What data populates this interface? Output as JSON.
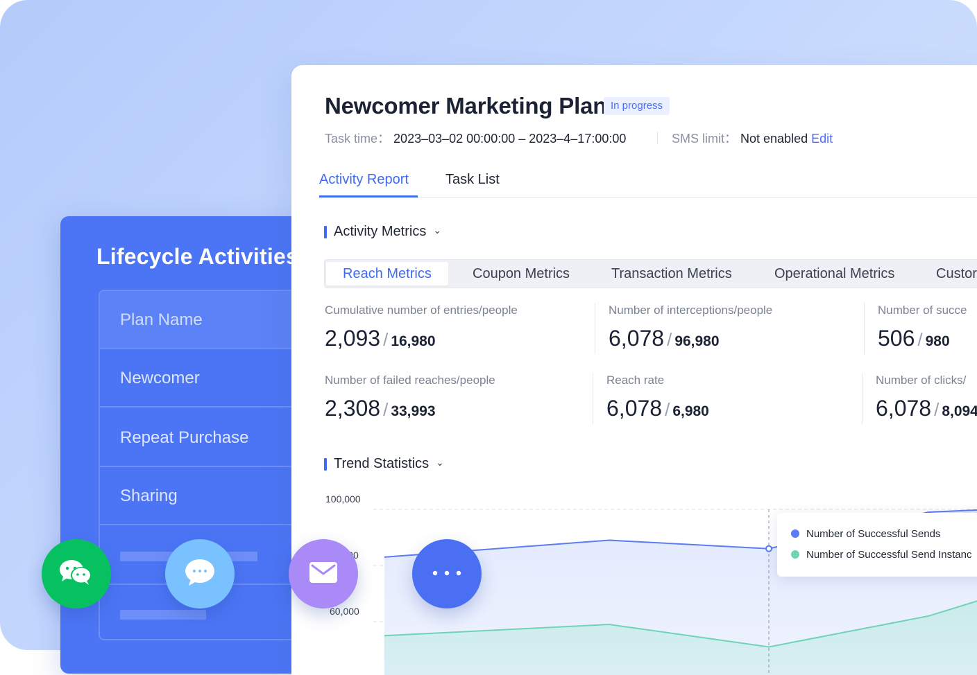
{
  "lifecycle": {
    "title": "Lifecycle Activities",
    "rows": [
      "Plan Name",
      "Newcomer",
      "Repeat Purchase",
      "Sharing"
    ]
  },
  "header": {
    "title": "Newcomer Marketing Plan",
    "status": "In progress",
    "task_time_label": "Task time：",
    "task_time_value": "2023–03–02 00:00:00 – 2023–4–17:00:00",
    "sms_label": "SMS limit：",
    "sms_value": "Not enabled",
    "edit_label": "Edit"
  },
  "tabs": [
    {
      "label": "Activity Report",
      "active": true
    },
    {
      "label": "Task List",
      "active": false
    }
  ],
  "sections": {
    "activity_metrics": "Activity Metrics",
    "trend_statistics": "Trend Statistics"
  },
  "segments": [
    "Reach Metrics",
    "Coupon Metrics",
    "Transaction Metrics",
    "Operational Metrics",
    "Custor"
  ],
  "metrics": [
    {
      "label": "Cumulative number of entries/people",
      "value": "2,093",
      "total": "16,980"
    },
    {
      "label": "Number of interceptions/people",
      "value": "6,078",
      "total": "96,980"
    },
    {
      "label": "Number of succe",
      "value": "506",
      "total": "980"
    },
    {
      "label": "Number of failed reaches/people",
      "value": "2,308",
      "total": "33,993"
    },
    {
      "label": "Reach rate",
      "value": "6,078",
      "total": "6,980"
    },
    {
      "label": "Number of clicks/",
      "value": "6,078",
      "total": "8,094"
    }
  ],
  "chart_data": {
    "type": "area",
    "y_ticks": [
      "100,000",
      "80,000",
      "60,000"
    ],
    "ylim": [
      50000,
      100000
    ],
    "series": [
      {
        "name": "Number of Successful Sends",
        "color": "#5b7cf2",
        "values": [
          83000,
          89000,
          86000,
          99000,
          100000
        ]
      },
      {
        "name": "Number of Successful Send Instanc",
        "color": "#6fd3b5",
        "values": [
          55000,
          59000,
          51000,
          62000,
          69000
        ]
      }
    ],
    "grid": true
  },
  "fabs": [
    {
      "icon": "wechat-icon",
      "color": "#07c160"
    },
    {
      "icon": "chat-bubble-icon",
      "color": "#79c2ff"
    },
    {
      "icon": "mail-icon",
      "color": "#a98af7"
    },
    {
      "icon": "more-icon",
      "color": "#4a6ff2"
    }
  ]
}
